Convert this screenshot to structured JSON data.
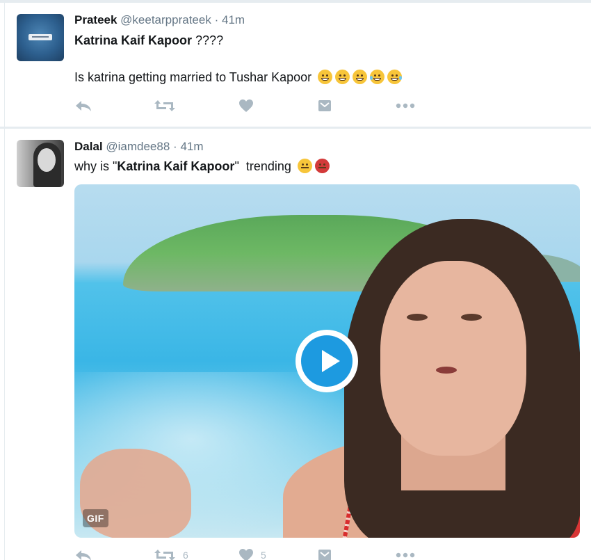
{
  "tweets": [
    {
      "name": "Prateek",
      "handle": "@keetarpprateek",
      "separator": "·",
      "time": "41m",
      "text_line1_bold": "Katrina Kaif Kapoor",
      "text_line1_rest": " ????",
      "text_line2": "Is katrina getting married to Tushar Kapoor",
      "emojis": [
        "wink-face-emoji",
        "grimace-face-emoji",
        "grimace-face-emoji",
        "tears-of-joy-emoji",
        "tears-of-joy-emoji"
      ],
      "retweet_count": "",
      "like_count": ""
    },
    {
      "name": "Dalal",
      "handle": "@iamdee88",
      "separator": "·",
      "time": "41m",
      "text_prefix": "why is \"",
      "text_bold": "Katrina Kaif Kapoor",
      "text_suffix": "\"  trending",
      "emojis": [
        "disappointed-face-emoji",
        "angry-face-emoji"
      ],
      "media_badge": "GIF",
      "retweet_count": "6",
      "like_count": "5"
    }
  ],
  "colors": {
    "action_icon": "#aab8c2",
    "handle_text": "#657786",
    "play_button": "#1d9ae0",
    "divider": "#e6ecf0"
  }
}
